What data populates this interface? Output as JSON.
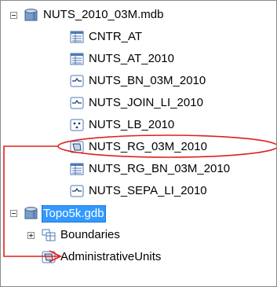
{
  "tree": {
    "root_db": {
      "label": "NUTS_2010_03M.mdb",
      "expanded": true,
      "icon": "database-icon",
      "children": [
        {
          "label": "CNTR_AT",
          "icon": "table-icon"
        },
        {
          "label": "NUTS_AT_2010",
          "icon": "table-icon"
        },
        {
          "label": "NUTS_BN_03M_2010",
          "icon": "line-featureclass-icon"
        },
        {
          "label": "NUTS_JOIN_LI_2010",
          "icon": "line-featureclass-icon"
        },
        {
          "label": "NUTS_LB_2010",
          "icon": "point-featureclass-icon"
        },
        {
          "label": "NUTS_RG_03M_2010",
          "icon": "polygon-featureclass-icon",
          "highlighted": true
        },
        {
          "label": "NUTS_RG_BN_03M_2010",
          "icon": "table-icon"
        },
        {
          "label": "NUTS_SEPA_LI_2010",
          "icon": "line-featureclass-icon"
        }
      ]
    },
    "gdb": {
      "label": "Topo5k.gdb",
      "expanded": true,
      "selected": true,
      "icon": "database-icon",
      "children": [
        {
          "label": "Boundaries",
          "icon": "feature-dataset-icon",
          "collapsed": true
        },
        {
          "label": "AdministrativeUnits",
          "icon": "polygon-featureclass-icon"
        }
      ]
    }
  },
  "annotation": {
    "ellipse_color": "#e0201e",
    "arrow_color": "#e0201e"
  },
  "colors": {
    "selection": "#3399ff",
    "icon_blue": "#4f79b5"
  }
}
